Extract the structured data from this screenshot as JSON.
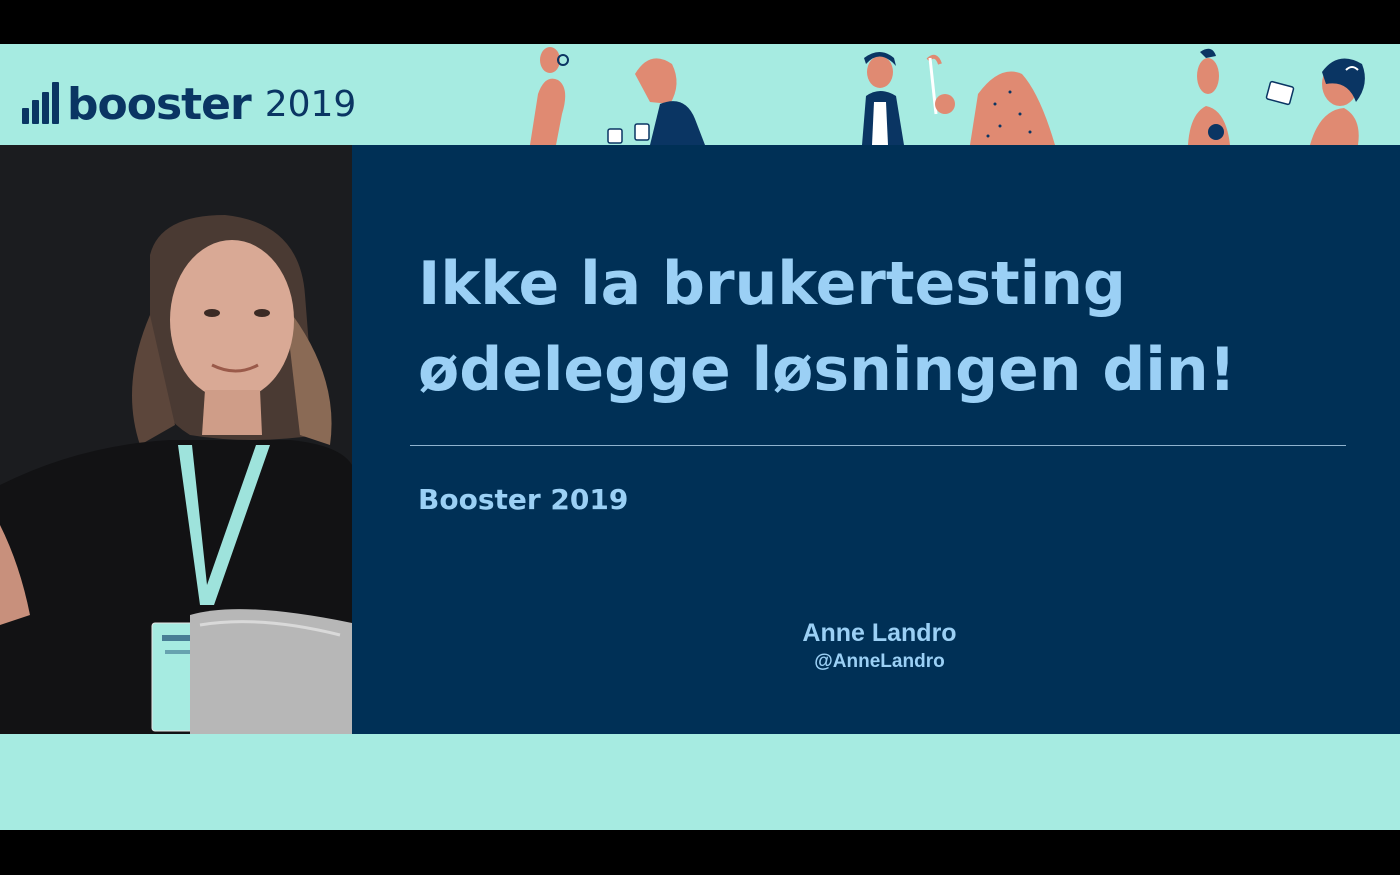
{
  "header": {
    "logo_word": "booster",
    "logo_year": "2019",
    "illustration_icon": "people-illustration-icon"
  },
  "video": {
    "subject_icon": "speaker-portrait-icon"
  },
  "slide": {
    "title_line1": "Ikke la brukertesting",
    "title_line2": "ødelegge løsningen din!",
    "subtitle": "Booster 2019",
    "speaker_name": "Anne Landro",
    "speaker_handle": "@AnneLandro"
  },
  "colors": {
    "mint": "#a6ebe1",
    "navy": "#003056",
    "title_blue": "#9bd0f5",
    "logo_navy": "#0a3563",
    "illustration_coral": "#e08a72"
  }
}
